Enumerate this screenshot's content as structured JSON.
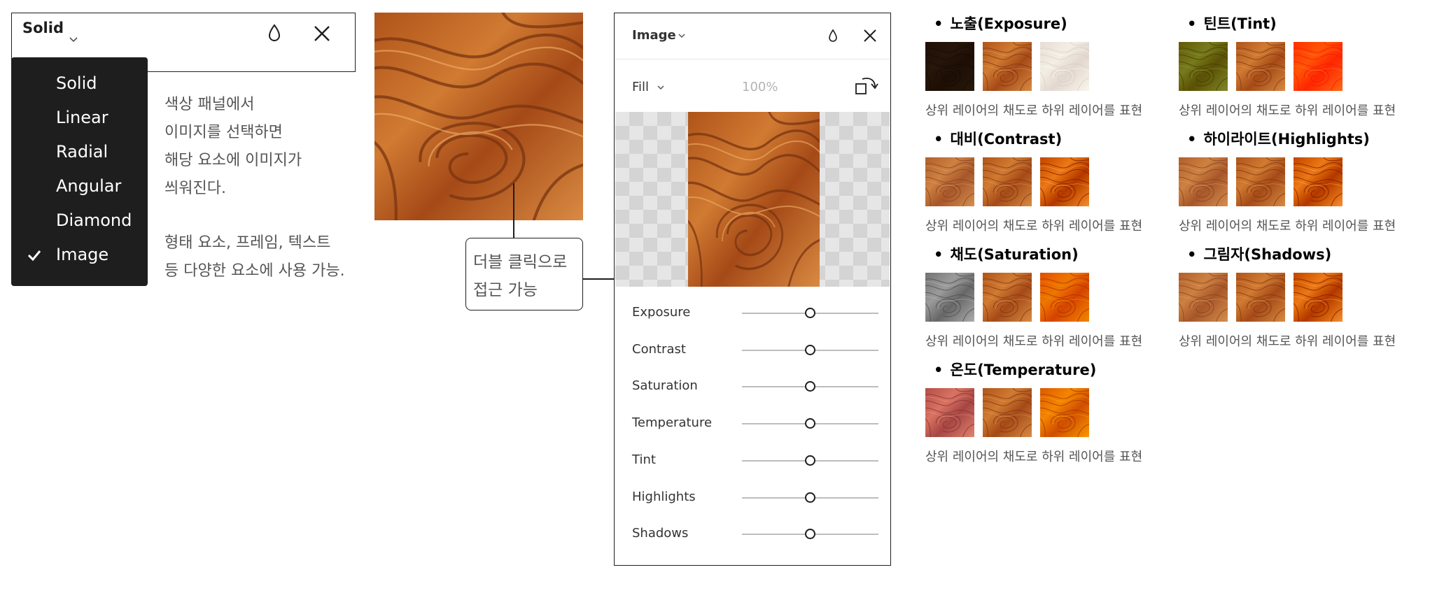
{
  "solid_panel": {
    "title": "Solid",
    "menu_items": [
      "Solid",
      "Linear",
      "Radial",
      "Angular",
      "Diamond",
      "Image"
    ],
    "selected": "Image"
  },
  "description": {
    "lines_1": [
      "색상 패널에서",
      "이미지를 선택하면",
      "해당 요소에 이미지가",
      "씌워진다."
    ],
    "lines_2": [
      "형태 요소, 프레임, 텍스트",
      "등 다양한 요소에 사용 가능."
    ]
  },
  "callout": {
    "lines": [
      "더블 클릭으로",
      "접근 가능"
    ]
  },
  "image_panel": {
    "title": "Image",
    "fill_label": "Fill",
    "opacity": "100%",
    "sliders": [
      {
        "label": "Exposure",
        "value": 0.5
      },
      {
        "label": "Contrast",
        "value": 0.5
      },
      {
        "label": "Saturation",
        "value": 0.5
      },
      {
        "label": "Temperature",
        "value": 0.5
      },
      {
        "label": "Tint",
        "value": 0.5
      },
      {
        "label": "Highlights",
        "value": 0.5
      },
      {
        "label": "Shadows",
        "value": 0.5
      }
    ]
  },
  "effects": [
    {
      "title": "노출(Exposure)",
      "caption": "상위 레이어의 채도로 하위 레이어를 표현",
      "variants": [
        "dark",
        "normal",
        "light"
      ]
    },
    {
      "title": "대비(Contrast)",
      "caption": "상위 레이어의 채도로 하위 레이어를 표현",
      "variants": [
        "low",
        "normal",
        "high"
      ]
    },
    {
      "title": "채도(Saturation)",
      "caption": "상위 레이어의 채도로 하위 레이어를 표현",
      "variants": [
        "gray",
        "normal",
        "vivid"
      ]
    },
    {
      "title": "온도(Temperature)",
      "caption": "상위 레이어의 채도로 하위 레이어를 표현",
      "variants": [
        "cool",
        "normal",
        "warm"
      ]
    },
    {
      "title": "틴트(Tint)",
      "caption": "상위 레이어의 채도로 하위 레이어를 표현",
      "variants": [
        "green",
        "normal",
        "red"
      ]
    },
    {
      "title": "하이라이트(Highlights)",
      "caption": "상위 레이어의 채도로 하위 레이어를 표현",
      "variants": [
        "low",
        "normal",
        "high"
      ]
    },
    {
      "title": "그림자(Shadows)",
      "caption": "상위 레이어의 채도로 하위 레이어를 표현",
      "variants": [
        "low",
        "normal",
        "high"
      ]
    }
  ],
  "colors": {
    "wood_dark": "#8a3f12",
    "wood_mid": "#c2621f",
    "wood_light": "#e59a4c",
    "panel_border": "#1e1e1e",
    "menu_bg": "#1e1e1e"
  }
}
